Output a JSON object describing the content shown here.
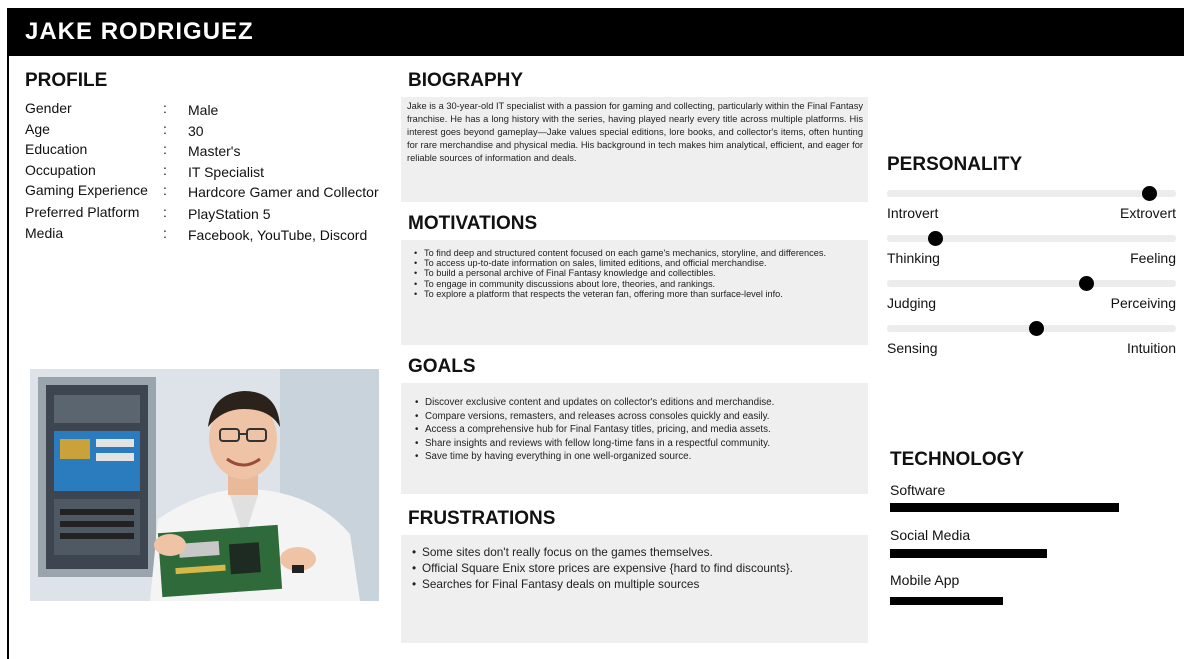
{
  "header": {
    "name": "JAKE RODRIGUEZ"
  },
  "profile": {
    "heading": "PROFILE",
    "rows": [
      {
        "key": "Gender",
        "value": "Male"
      },
      {
        "key": "Age",
        "value": "30"
      },
      {
        "key": "Education",
        "value": "Master's"
      },
      {
        "key": "Occupation",
        "value": "IT Specialist"
      },
      {
        "key": "Gaming Experience",
        "value": "Hardcore Gamer and Collector"
      },
      {
        "key": "Preferred Platform",
        "value": "PlayStation 5"
      },
      {
        "key": "Media",
        "value": "Facebook, YouTube, Discord"
      }
    ],
    "separator": ":"
  },
  "biography": {
    "heading": "BIOGRAPHY",
    "text": "Jake is a 30-year-old IT specialist with a passion for gaming and collecting, particularly within the Final Fantasy franchise. He has a long history with the series, having played nearly every title across multiple platforms. His interest goes beyond gameplay—Jake values special editions, lore books, and collector's items, often hunting for rare merchandise and physical media. His background in tech makes him analytical, efficient, and eager for reliable sources of information and deals."
  },
  "motivations": {
    "heading": "MOTIVATIONS",
    "items": [
      "To find deep and structured content focused on each game's mechanics, storyline, and differences.",
      "To access up-to-date information on sales, limited editions, and official merchandise.",
      "To build a personal archive of Final Fantasy knowledge and collectibles.",
      "To engage in community discussions about lore, theories, and rankings.",
      "To explore a platform that respects the veteran fan, offering more than surface-level info."
    ]
  },
  "goals": {
    "heading": "GOALS",
    "items": [
      "Discover exclusive content and updates on collector's editions and merchandise.",
      "Compare versions, remasters, and releases across consoles quickly and easily.",
      "Access a comprehensive hub for Final Fantasy titles, pricing, and media assets.",
      "Share insights and reviews with fellow long-time fans in a respectful community.",
      "Save time by having everything in one well-organized source."
    ]
  },
  "frustrations": {
    "heading": "FRUSTRATIONS",
    "items": [
      "Some sites don't really focus on the games themselves.",
      "Official Square Enix store prices are expensive {hard to find discounts}.",
      "Searches for Final Fantasy deals on multiple sources"
    ]
  },
  "personality": {
    "heading": "PERSONALITY",
    "traits": [
      {
        "left": "Introvert",
        "right": "Extrovert",
        "level": 0.93
      },
      {
        "left": "Thinking",
        "right": "Feeling",
        "level": 0.15
      },
      {
        "left": "Judging",
        "right": "Perceiving",
        "level": 0.7
      },
      {
        "left": "Sensing",
        "right": "Intuition",
        "level": 0.52
      }
    ]
  },
  "technology": {
    "heading": "TECHNOLOGY",
    "items": [
      {
        "label": "Software",
        "level": 0.79
      },
      {
        "label": "Social Media",
        "level": 0.54
      },
      {
        "label": "Mobile App",
        "level": 0.39
      }
    ]
  },
  "colors": {
    "header_bg": "#000000",
    "box_bg": "#efefef",
    "accent": "#000000"
  }
}
